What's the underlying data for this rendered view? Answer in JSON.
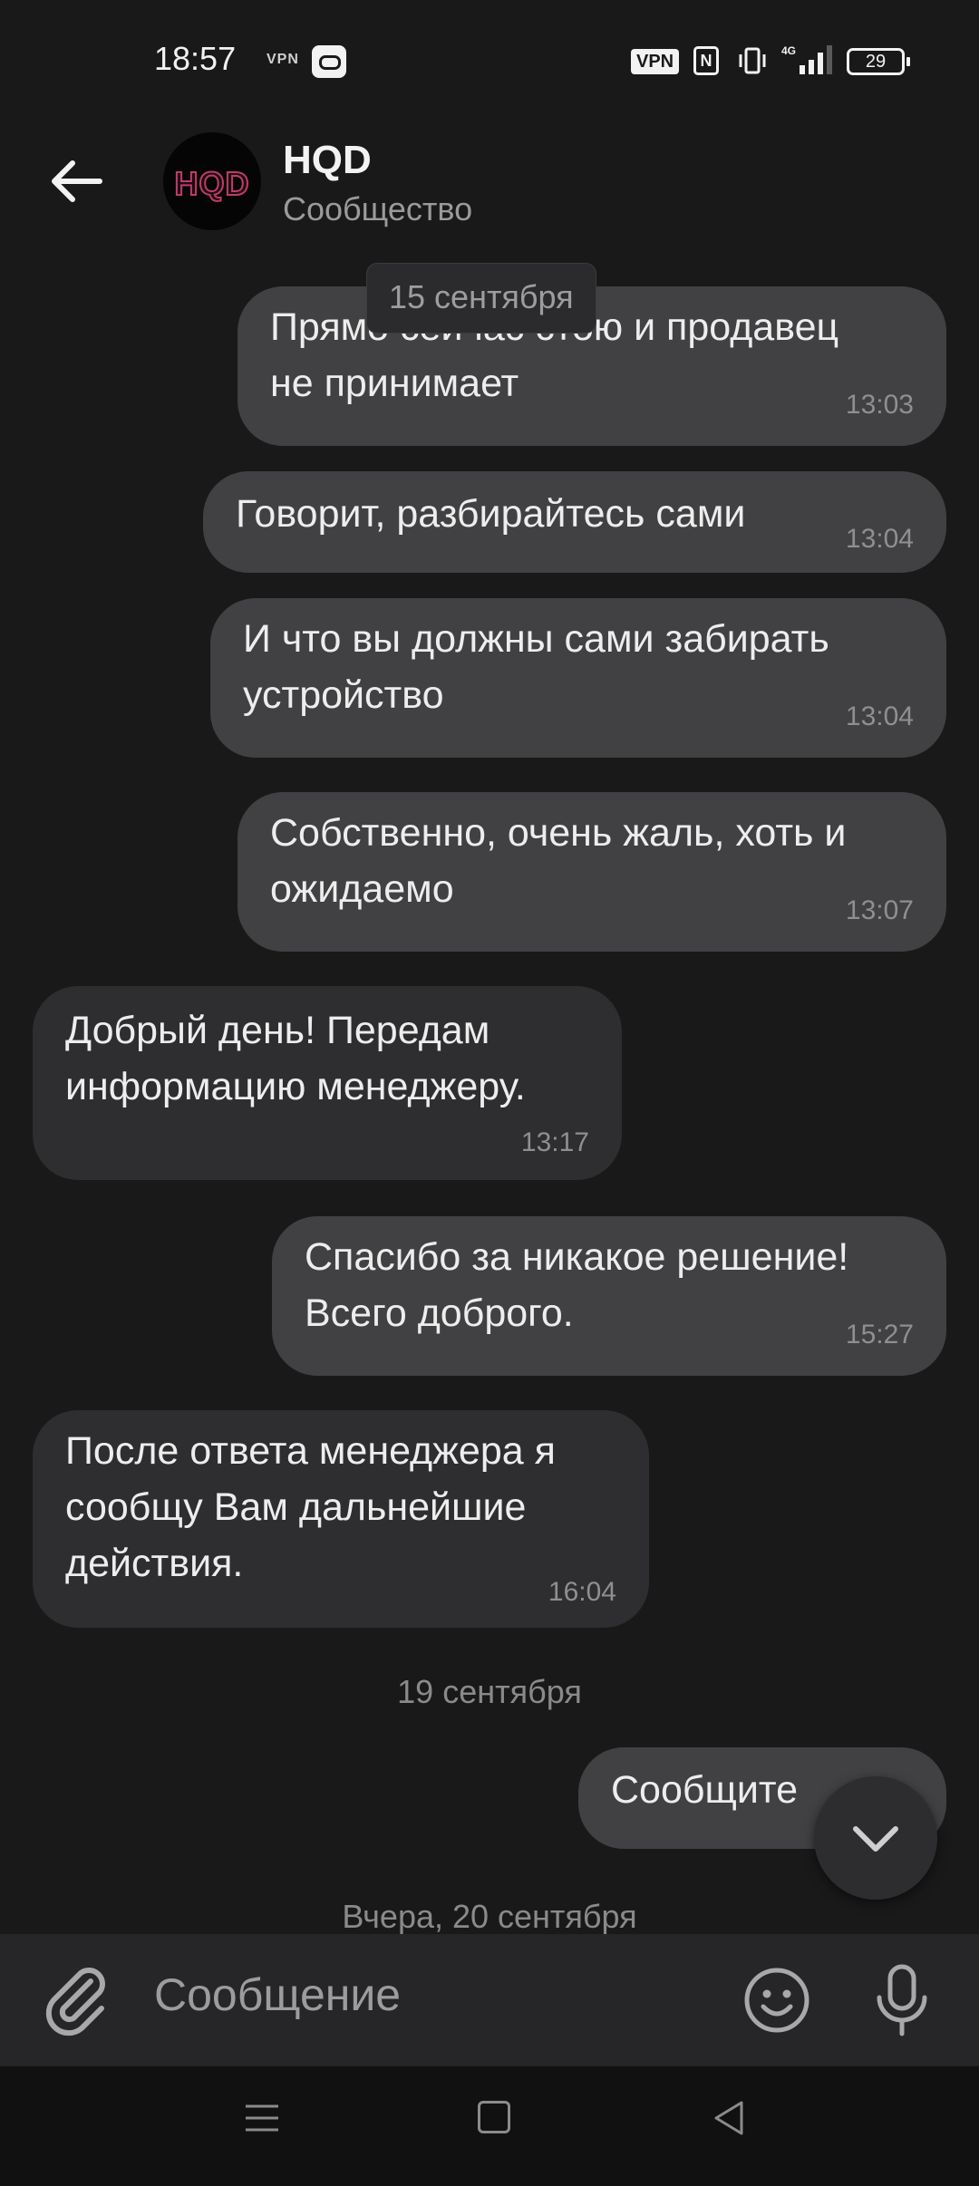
{
  "status_bar": {
    "time": "18:57",
    "vpn_small": "VPN",
    "vpn_badge": "VPN",
    "nfc": "N",
    "network": "4G",
    "battery": "29"
  },
  "header": {
    "avatar_text": "HQD",
    "title": "HQD",
    "subtitle": "Сообщество",
    "back_icon": "arrow-left-icon"
  },
  "chat": {
    "floating_date": "15 сентября",
    "messages": [
      {
        "text": "Прямо сейчас стою и продавец\nне принимает",
        "time": "13:03",
        "dir": "out"
      },
      {
        "text": "Говорит, разбирайтесь сами",
        "time": "13:04",
        "dir": "out"
      },
      {
        "text": "И что вы должны сами забирать\nустройство",
        "time": "13:04",
        "dir": "out"
      },
      {
        "text": "Собственно, очень жаль, хоть и\nожидаемо",
        "time": "13:07",
        "dir": "out"
      },
      {
        "text": "Добрый день! Передам\nинформацию менеджеру.",
        "time": "13:17",
        "dir": "in"
      },
      {
        "text": "Спасибо за никакое решение!\nВсего доброго.",
        "time": "15:27",
        "dir": "out"
      },
      {
        "text": "После ответа менеджера я\nсообщу Вам дальнейшие\nдействия.",
        "time": "16:04",
        "dir": "in"
      },
      {
        "text": "Сообщите",
        "time": "",
        "dir": "out"
      }
    ],
    "date_separators": [
      "19 сентября",
      "Вчера, 20 сентября"
    ]
  },
  "input": {
    "placeholder": "Сообщение",
    "attach_icon": "paperclip-icon",
    "emoji_icon": "emoji-icon",
    "mic_icon": "microphone-icon"
  },
  "colors": {
    "background": "#191919",
    "bubble_out": "#414143",
    "bubble_in": "#2e2e30",
    "avatar_accent": "#c03b6a"
  }
}
